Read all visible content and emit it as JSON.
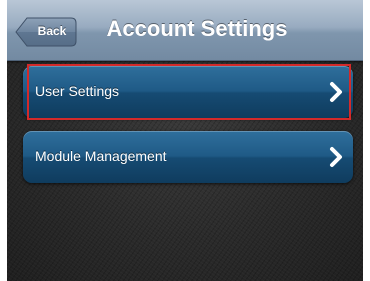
{
  "colors": {
    "navbar": "#8ea3b9",
    "row_fill": "#1f5a86",
    "selection_outline": "#d42a2a",
    "background": "#2a2a2a"
  },
  "navbar": {
    "back_label": "Back",
    "title": "Account Settings"
  },
  "menu": {
    "items": [
      {
        "label": "User Settings",
        "icon": "chevron-right-icon",
        "selected": true
      },
      {
        "label": "Module Management",
        "icon": "chevron-right-icon",
        "selected": false
      }
    ]
  }
}
